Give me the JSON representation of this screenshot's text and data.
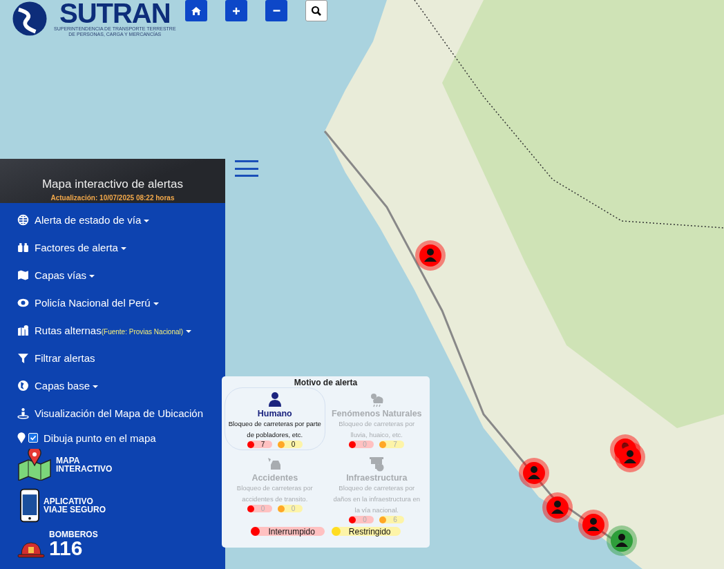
{
  "logo": {
    "name": "SUTRAN",
    "subtitle_lines": [
      "SUPERINTENDENCIA DE TRANSPORTE TERRESTRE",
      "DE PERSONAS, CARGA Y MERCANCÍAS"
    ]
  },
  "map_controls": [
    {
      "kind": "home"
    },
    {
      "kind": "plus"
    },
    {
      "kind": "minus"
    },
    {
      "kind": "search"
    }
  ],
  "sidebar": {
    "title": "Mapa interactivo de alertas",
    "updated": "Actualización: 10/07/2025 08:22 horas",
    "items": [
      {
        "label": "Alerta de estado de vía",
        "dropdown": true
      },
      {
        "label": "Factores de alerta",
        "dropdown": true
      },
      {
        "label": "Capas vías",
        "dropdown": true
      },
      {
        "label": "Policía Nacional del Perú",
        "dropdown": true
      },
      {
        "label": "Rutas alternas",
        "note": "(Fuente: Provias Nacional)",
        "dropdown": true
      },
      {
        "label": "Filtrar alertas",
        "dropdown": false
      },
      {
        "label": "Capas base",
        "dropdown": true
      },
      {
        "label": "Visualización del Mapa de Ubicación",
        "dropdown": false
      }
    ],
    "draw_point": {
      "label": "Dibuja punto en el mapa",
      "checked": true
    },
    "links": [
      {
        "kind": "map",
        "lines": [
          "MAPA",
          "INTERACTIVO"
        ]
      },
      {
        "kind": "phone",
        "lines": [
          "APLICATIVO",
          "VIAJE SEGURO"
        ]
      },
      {
        "kind": "fire",
        "lines": [
          "BOMBEROS",
          "116"
        ]
      }
    ]
  },
  "legend": {
    "title": "Motivo de alerta",
    "categories": [
      {
        "name": "Humano",
        "description": "Bloqueo de carreteras por parte de pobladores, etc.",
        "selected": true,
        "interrupted": "7",
        "restricted": "0"
      },
      {
        "name": "Fenómenos Naturales",
        "description": "Bloqueo de carreteras por lluvia, huaico, etc.",
        "selected": false,
        "interrupted": "0",
        "restricted": "7"
      },
      {
        "name": "Accidentes",
        "description": "Bloqueo de carreteras por accidentes de transito.",
        "selected": false,
        "interrupted": "0",
        "restricted": "0"
      },
      {
        "name": "Infraestructura",
        "description": "Bloqueo de carreteras por daños en la infraestructura en la vía nacional.",
        "selected": false,
        "interrupted": "0",
        "restricted": "6"
      }
    ],
    "keys": [
      {
        "label": "Interrumpido",
        "color": "#ff0000"
      },
      {
        "label": "Restringido",
        "color": "#ffdd22"
      }
    ]
  }
}
